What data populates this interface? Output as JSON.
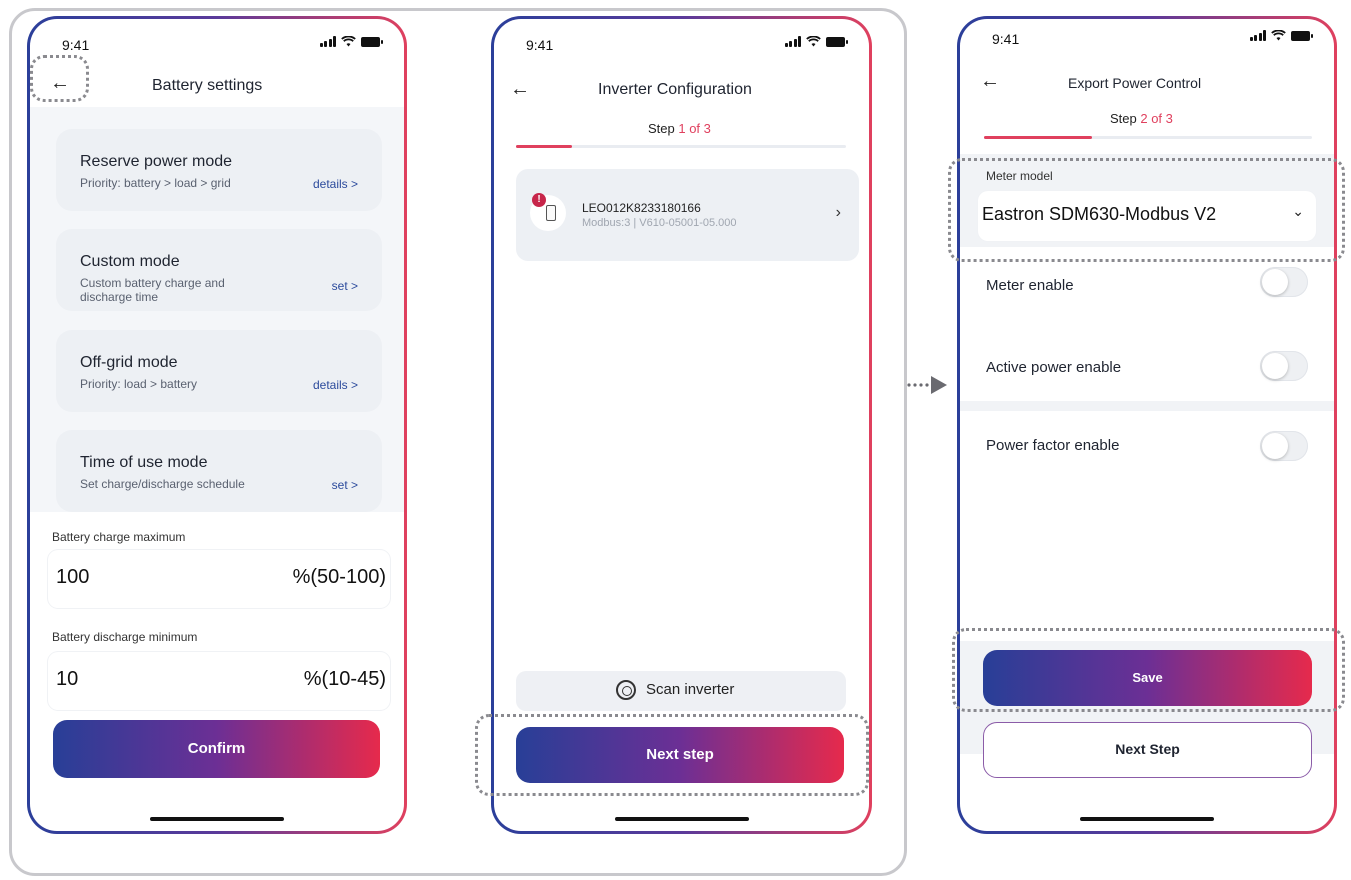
{
  "status": {
    "time": "9:41"
  },
  "screen1": {
    "title": "Battery settings",
    "modes": [
      {
        "title": "Reserve power mode",
        "desc": "Priority: battery > load > grid",
        "link": "details >"
      },
      {
        "title": "Custom mode",
        "desc": "Custom battery charge and discharge time",
        "link": "set >"
      },
      {
        "title": "Off-grid mode",
        "desc": "Priority: load > battery",
        "link": "details >"
      },
      {
        "title": "Time of use mode",
        "desc": "Set charge/discharge schedule",
        "link": "set >"
      }
    ],
    "charge_max": {
      "label": "Battery charge maximum",
      "value": "100",
      "range": "%(50-100)"
    },
    "discharge_min": {
      "label": "Battery discharge minimum",
      "value": "10",
      "range": "%(10-45)"
    },
    "confirm_label": "Confirm"
  },
  "screen2": {
    "title": "Inverter Configuration",
    "step_prefix": "Step ",
    "step_value": "1 of 3",
    "progress": 0.17,
    "device": {
      "name": "LEO012K8233180166",
      "sub": "Modbus:3 | V610-05001-05.000",
      "alert": "!"
    },
    "scan_label": "Scan inverter",
    "next_label": "Next step"
  },
  "screen3": {
    "title": "Export Power Control",
    "step_prefix": "Step ",
    "step_value": "2 of 3",
    "progress": 0.33,
    "meter_label": "Meter model",
    "meter_value": "Eastron SDM630-Modbus V2",
    "toggles": [
      {
        "label": "Meter enable",
        "on": false
      },
      {
        "label": "Active power enable",
        "on": false
      },
      {
        "label": "Power factor enable",
        "on": false
      }
    ],
    "save_label": "Save",
    "next_label": "Next Step"
  },
  "colors": {
    "accent": "#e0405e",
    "brand_blue": "#2b3f9a",
    "brand_purple": "#6c2f95"
  }
}
